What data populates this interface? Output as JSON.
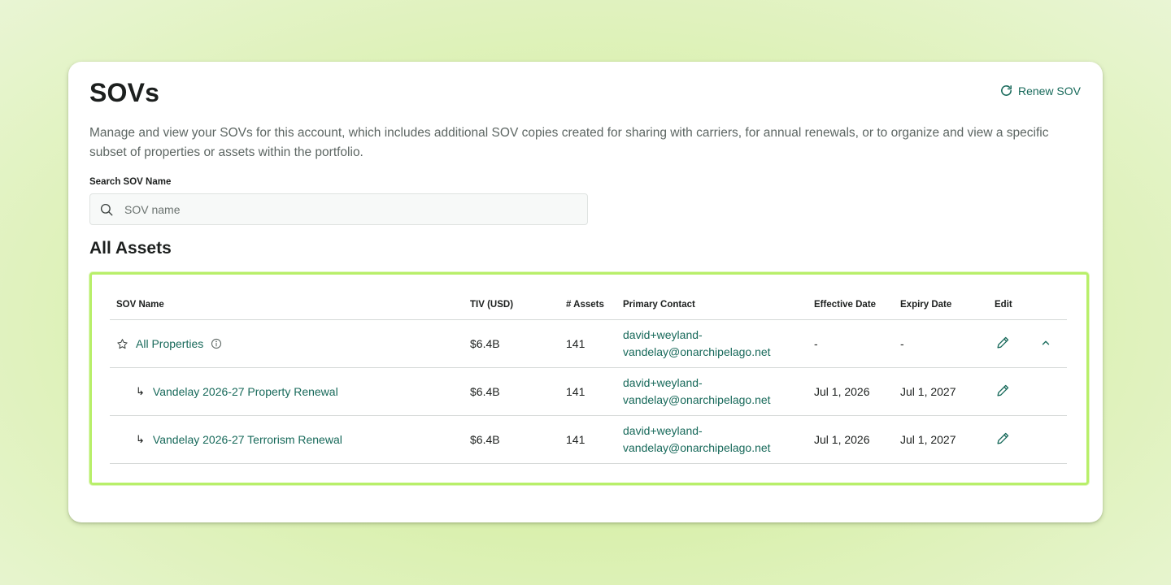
{
  "page": {
    "title": "SOVs",
    "description": "Manage and view your SOVs for this account, which includes additional SOV copies created for sharing with carriers, for annual renewals, or to organize and view a specific subset of properties or assets within the portfolio.",
    "renew_label": "Renew SOV"
  },
  "search": {
    "label": "Search SOV Name",
    "placeholder": "SOV name",
    "value": ""
  },
  "section": {
    "title": "All Assets"
  },
  "table": {
    "headers": {
      "name": "SOV Name",
      "tiv": "TIV (USD)",
      "assets": "# Assets",
      "contact": "Primary Contact",
      "effective": "Effective Date",
      "expiry": "Expiry Date",
      "edit": "Edit"
    },
    "rows": [
      {
        "name": "All Properties",
        "tiv": "$6.4B",
        "assets": "141",
        "contact_line1": "david+weyland-",
        "contact_line2": "vandelay@onarchipelago.net",
        "effective": "-",
        "expiry": "-"
      },
      {
        "name": "Vandelay 2026-27 Property Renewal",
        "tiv": "$6.4B",
        "assets": "141",
        "contact_line1": "david+weyland-",
        "contact_line2": "vandelay@onarchipelago.net",
        "effective": "Jul 1, 2026",
        "expiry": "Jul 1, 2027"
      },
      {
        "name": "Vandelay 2026-27 Terrorism Renewal",
        "tiv": "$6.4B",
        "assets": "141",
        "contact_line1": "david+weyland-",
        "contact_line2": "vandelay@onarchipelago.net",
        "effective": "Jul 1, 2026",
        "expiry": "Jul 1, 2027"
      }
    ],
    "child_arrow": "↳"
  },
  "colors": {
    "accent": "#17695a",
    "highlight_border": "#b8ef6a",
    "background": "#d9f0ad"
  },
  "icons": [
    "refresh-icon",
    "search-icon",
    "star-icon",
    "info-icon",
    "pencil-icon",
    "chevron-up-icon"
  ]
}
